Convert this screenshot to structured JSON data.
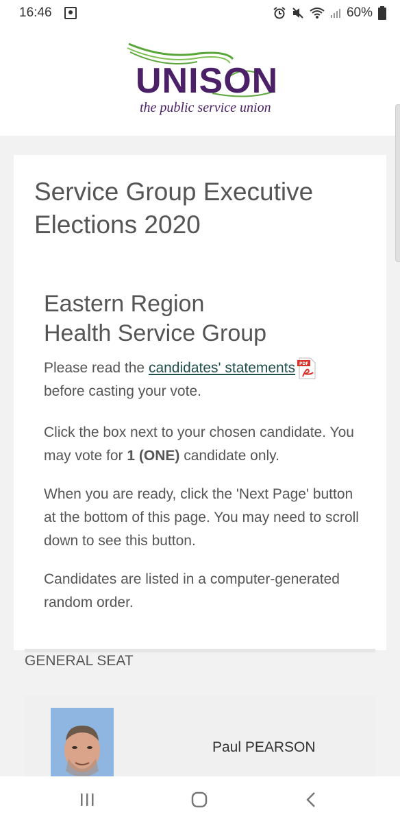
{
  "status_bar": {
    "time": "16:46",
    "battery": "60%",
    "icons": [
      "notification-icon",
      "alarm-icon",
      "mute-icon",
      "wifi-icon",
      "signal-icon",
      "battery-icon"
    ]
  },
  "header": {
    "logo_text": "UNISON",
    "tagline": "the public service union",
    "brand_color": "#4b2067",
    "accent_color": "#5aa63a"
  },
  "page": {
    "title": "Service Group Executive Elections 2020",
    "region_heading_line1": "Eastern Region",
    "region_heading_line2": "Health Service Group",
    "read_prefix": "Please read the ",
    "statements_link": "candidates' statements",
    "read_suffix": "before casting your vote.",
    "click_text": "Click the box next to your chosen candidate. You may vote for ",
    "vote_limit": "1 (ONE)",
    "vote_suffix": " candidate only.",
    "ready_text": "When you are ready, click the 'Next Page' button at the bottom of this page.  You may need to scroll down to see this button.",
    "order_text": "Candidates are listed in a computer-generated random order."
  },
  "ballot": {
    "section_label": "GENERAL SEAT",
    "candidates": [
      {
        "name": "Paul PEARSON"
      }
    ]
  },
  "nav": {
    "icons": [
      "recent-apps-icon",
      "home-icon",
      "back-icon"
    ]
  }
}
